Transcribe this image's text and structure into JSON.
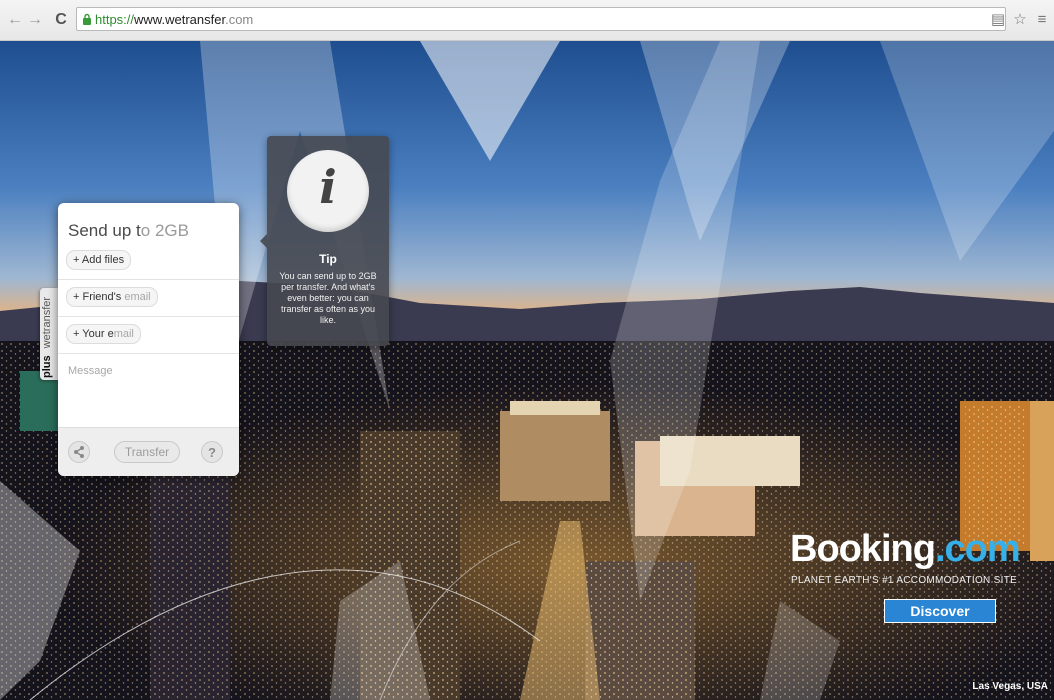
{
  "browser": {
    "url_scheme": "https://",
    "url_host": "www.wetransfer",
    "url_rest": ".com",
    "back_icon": "arrow-left-icon",
    "forward_icon": "arrow-right-icon",
    "reload_icon": "reload-icon",
    "lock_icon": "lock-icon",
    "star_icon": "star-icon",
    "menu_icon": "menu-icon"
  },
  "side_tab": {
    "plus": "plus",
    "brand": "wetransfer"
  },
  "panel": {
    "title_start": "Send up t",
    "title_accent": "o 2GB",
    "add_files": "+ Add files",
    "friend_prefix": "+ Friend's ",
    "friend_muted": "email",
    "your_prefix": "+ Your e",
    "your_muted": "mail",
    "message_placeholder": "Message",
    "transfer_label": "Transfer",
    "help_label": "?",
    "share_icon": "share-icon"
  },
  "tip": {
    "icon": "info-icon",
    "glyph": "i",
    "title": "Tip",
    "text": "You can send up to 2GB per transfer. And what's even better: you can transfer as often as you like."
  },
  "ad": {
    "brand_main": "Booking",
    "brand_tld": ".com",
    "tagline": "PLANET EARTH'S #1 ACCOMMODATION SITE",
    "cta": "Discover",
    "location": "Las Vegas, USA",
    "brand_color": "#35b0e8"
  }
}
